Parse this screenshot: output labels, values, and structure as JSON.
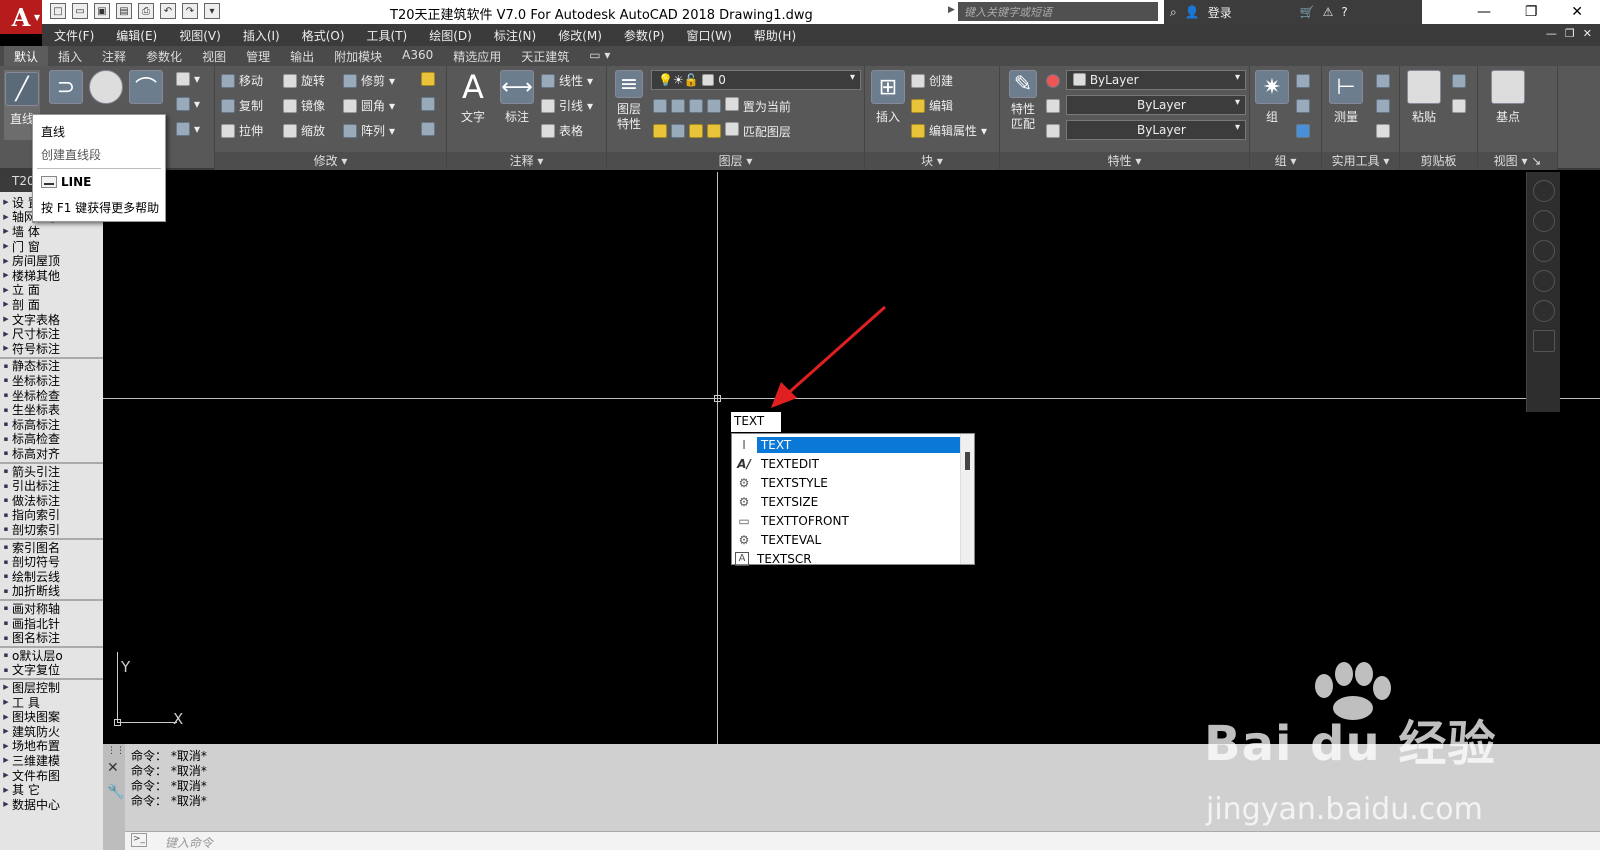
{
  "app": {
    "logo": "A",
    "title": "T20天正建筑软件 V7.0 For Autodesk AutoCAD 2018    Drawing1.dwg",
    "search_placeholder": "键入关键字或短语",
    "login": "登录"
  },
  "menu": [
    "文件(F)",
    "编辑(E)",
    "视图(V)",
    "插入(I)",
    "格式(O)",
    "工具(T)",
    "绘图(D)",
    "标注(N)",
    "修改(M)",
    "参数(P)",
    "窗口(W)",
    "帮助(H)"
  ],
  "ribbon_tabs": [
    "默认",
    "插入",
    "注释",
    "参数化",
    "视图",
    "管理",
    "输出",
    "附加模块",
    "A360",
    "精选应用",
    "天正建筑"
  ],
  "ribbon": {
    "draw_line": "直线",
    "modify": {
      "title": "修改",
      "items": [
        "移动",
        "旋转",
        "修剪",
        "复制",
        "镜像",
        "圆角",
        "拉伸",
        "缩放",
        "阵列"
      ]
    },
    "annotation": {
      "title": "注释",
      "text": "文字",
      "dim": "标注",
      "linear": "线性",
      "leader": "引线",
      "table": "表格"
    },
    "layers": {
      "title": "图层",
      "props": "图层\n特性",
      "current_layer": "0",
      "set_current": "置为当前",
      "match": "匹配图层"
    },
    "block": {
      "title": "块",
      "insert": "插入",
      "create": "创建",
      "edit": "编辑",
      "edit_attr": "编辑属性"
    },
    "properties": {
      "title": "特性",
      "match": "特性\n匹配",
      "color": "ByLayer",
      "linetype": "ByLayer",
      "lineweight": "ByLayer"
    },
    "group": {
      "title": "组",
      "label": "组"
    },
    "utilities": {
      "title": "实用工具",
      "measure": "测量"
    },
    "clipboard": {
      "title": "剪贴板",
      "paste": "粘贴"
    },
    "view": {
      "title": "视图",
      "base": "基点"
    }
  },
  "tooltip": {
    "title": "直线",
    "desc": "创建直线段",
    "command": "LINE",
    "help": "按 F1 键获得更多帮助"
  },
  "palette": {
    "tab": "T20",
    "items_a": [
      "设  置",
      "轴网柱子",
      "墙    体",
      "门    窗",
      "房间屋顶",
      "楼梯其他",
      "立    面",
      "剖    面",
      "文字表格",
      "尺寸标注",
      "符号标注"
    ],
    "items_b": [
      "静态标注",
      "坐标标注",
      "坐标检查",
      "生坐标表",
      "标高标注",
      "标高检查",
      "标高对齐"
    ],
    "items_c": [
      "箭头引注",
      "引出标注",
      "做法标注",
      "指向索引",
      "剖切索引"
    ],
    "items_d": [
      "索引图名",
      "剖切符号",
      "绘制云线",
      "加折断线"
    ],
    "items_e": [
      "画对称轴",
      "画指北针",
      "图名标注"
    ],
    "items_f": [
      "o默认层o",
      "文字复位"
    ],
    "items_g": [
      "图层控制",
      "工    具",
      "图块图案",
      "建筑防火",
      "场地布置",
      "三维建模",
      "文件布图",
      "其    它",
      "数据中心"
    ]
  },
  "canvas": {
    "input_text": "TEXT",
    "autocomplete": [
      {
        "label": "TEXT",
        "icon": "text-cursor-icon"
      },
      {
        "label": "TEXTEDIT",
        "icon": "text-edit-icon"
      },
      {
        "label": "TEXTSTYLE",
        "icon": "gear-icon"
      },
      {
        "label": "TEXTSIZE",
        "icon": "gear-icon"
      },
      {
        "label": "TEXTTOFRONT",
        "icon": "bring-front-icon"
      },
      {
        "label": "TEXTEVAL",
        "icon": "gear-icon"
      },
      {
        "label": "TEXTSCR",
        "icon": "text-a-icon"
      }
    ],
    "ucs_x": "X",
    "ucs_y": "Y"
  },
  "command": {
    "history": [
      "命令：  *取消*",
      "命令：  *取消*",
      "命令：  *取消*",
      "命令：  *取消*"
    ],
    "placeholder": "键入命令"
  },
  "watermark": {
    "main": "Bai du 经验",
    "sub": "jingyan.baidu.com"
  },
  "colors": {
    "accent": "#0a78d7",
    "logo": "#b71c1c",
    "arrow": "#e02020"
  }
}
